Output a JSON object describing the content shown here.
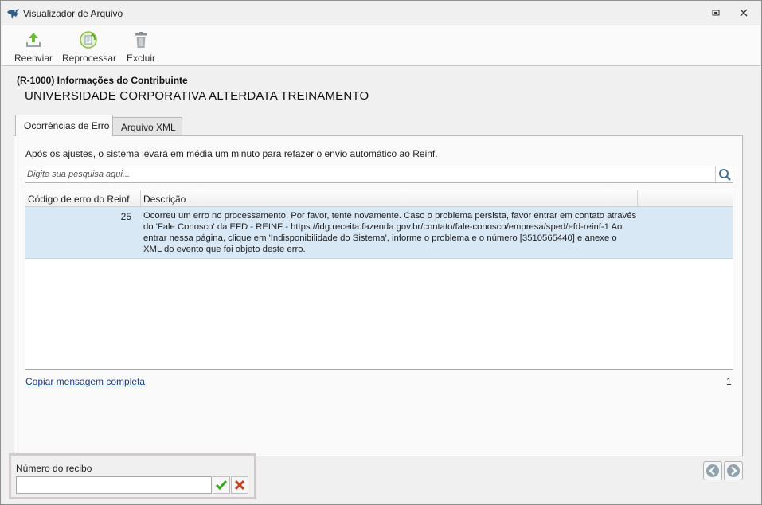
{
  "window": {
    "title": "Visualizador de Arquivo",
    "app_icon": "bird-logo-icon",
    "restore_icon": "restore-window-icon",
    "close_icon": "close-icon"
  },
  "toolbar": {
    "buttons": [
      {
        "label": "Reenviar",
        "icon": "upload-icon"
      },
      {
        "label": "Reprocessar",
        "icon": "reprocess-icon"
      },
      {
        "label": "Excluir",
        "icon": "trash-icon"
      }
    ]
  },
  "contributor": {
    "code_title": "(R-1000) Informações do Contribuinte",
    "name": "UNIVERSIDADE CORPORATIVA ALTERDATA TREINAMENTO"
  },
  "tabs": [
    {
      "label": "Ocorrências de Erro",
      "active": true
    },
    {
      "label": "Arquivo XML",
      "active": false
    }
  ],
  "errors_panel": {
    "info": "Após os ajustes, o sistema levará em média um minuto para refazer o envio automático ao Reinf.",
    "search_placeholder": "Digite sua pesquisa aqui...",
    "columns": [
      "Código de erro do Reinf",
      "Descrição",
      ""
    ],
    "rows": [
      {
        "code": "25",
        "description": "Ocorreu um erro no processamento. Por favor, tente novamente. Caso o problema persista, favor entrar em contato através do 'Fale Conosco' da EFD - REINF - https://idg.receita.fazenda.gov.br/contato/fale-conosco/empresa/sped/efd-reinf-1 Ao entrar nessa página, clique em 'Indisponibilidade do Sistema', informe o problema e o número [3510565440] e anexe o XML do evento que foi objeto deste erro."
      }
    ],
    "copy_link": "Copiar mensagem completa",
    "count": "1"
  },
  "receipt": {
    "label": "Número do recibo",
    "value": ""
  },
  "colors": {
    "selected_row": "#d9e8f5",
    "link": "#1a3c8e",
    "confirm_green": "#3aa31e",
    "cancel_red": "#c8401e"
  }
}
